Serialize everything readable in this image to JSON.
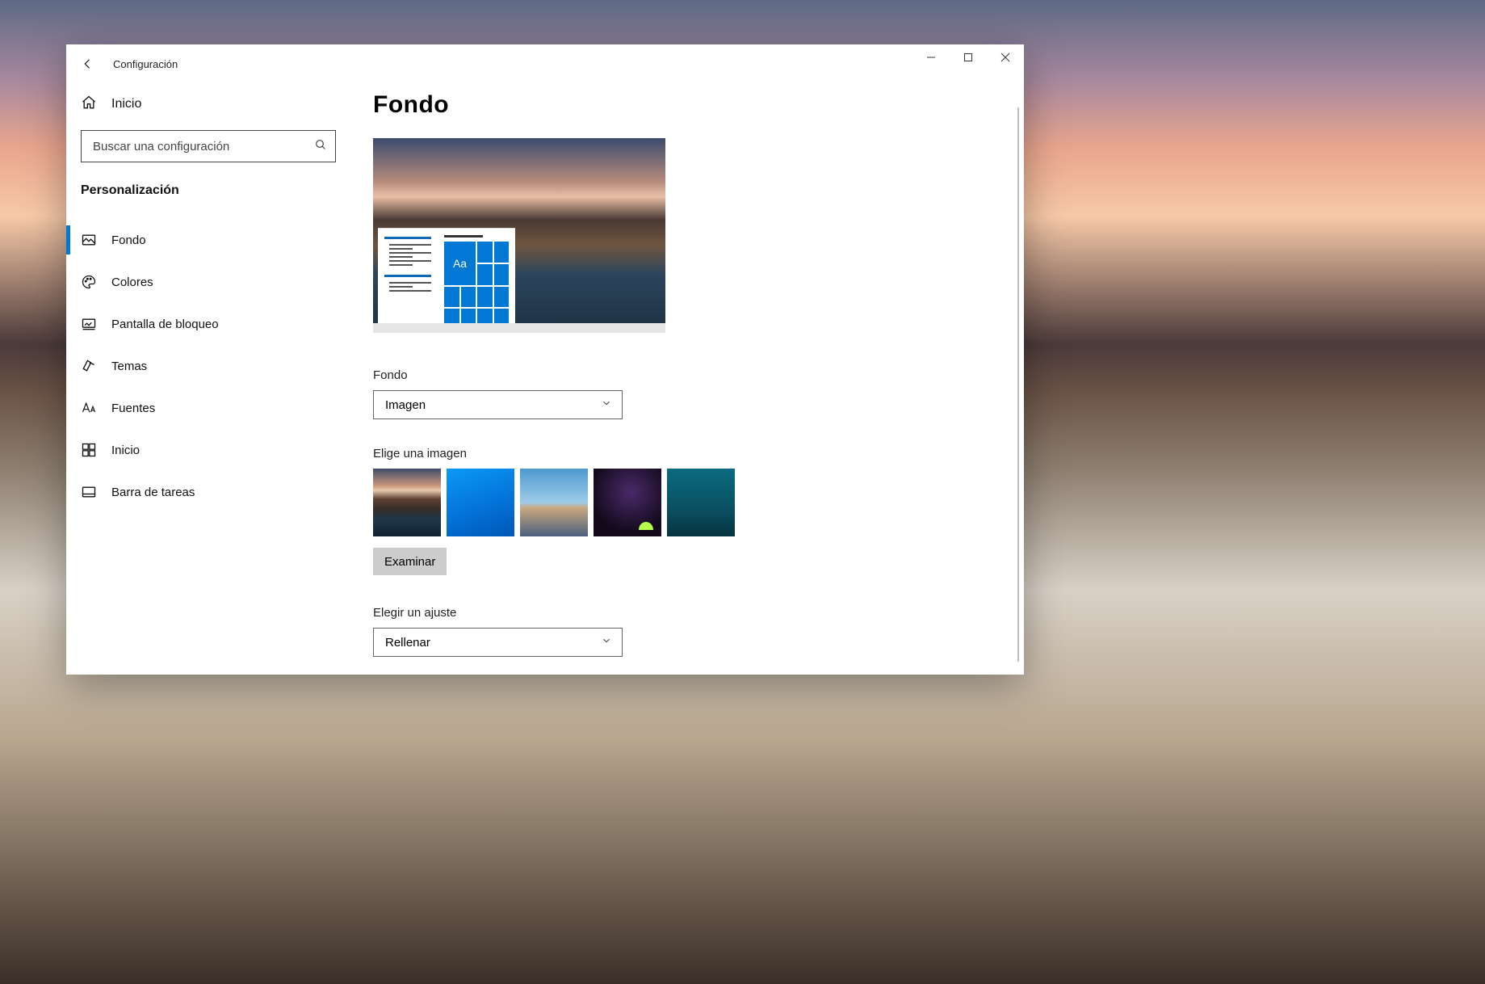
{
  "app": {
    "title": "Configuración"
  },
  "window_controls": {
    "minimize": "minimize",
    "maximize": "maximize",
    "close": "close"
  },
  "sidebar": {
    "home_label": "Inicio",
    "search_placeholder": "Buscar una configuración",
    "section_title": "Personalización",
    "items": [
      {
        "label": "Fondo",
        "icon": "picture",
        "active": true
      },
      {
        "label": "Colores",
        "icon": "palette",
        "active": false
      },
      {
        "label": "Pantalla de bloqueo",
        "icon": "lockscreen",
        "active": false
      },
      {
        "label": "Temas",
        "icon": "themes",
        "active": false
      },
      {
        "label": "Fuentes",
        "icon": "fonts",
        "active": false
      },
      {
        "label": "Inicio",
        "icon": "start",
        "active": false
      },
      {
        "label": "Barra de tareas",
        "icon": "taskbar",
        "active": false
      }
    ]
  },
  "page": {
    "title": "Fondo",
    "preview_tile_text": "Aa",
    "background_label": "Fondo",
    "background_value": "Imagen",
    "choose_image_label": "Elige una imagen",
    "browse_label": "Examinar",
    "fit_label": "Elegir un ajuste",
    "fit_value": "Rellenar",
    "thumb_count": 5
  },
  "colors": {
    "accent": "#0078d4"
  }
}
